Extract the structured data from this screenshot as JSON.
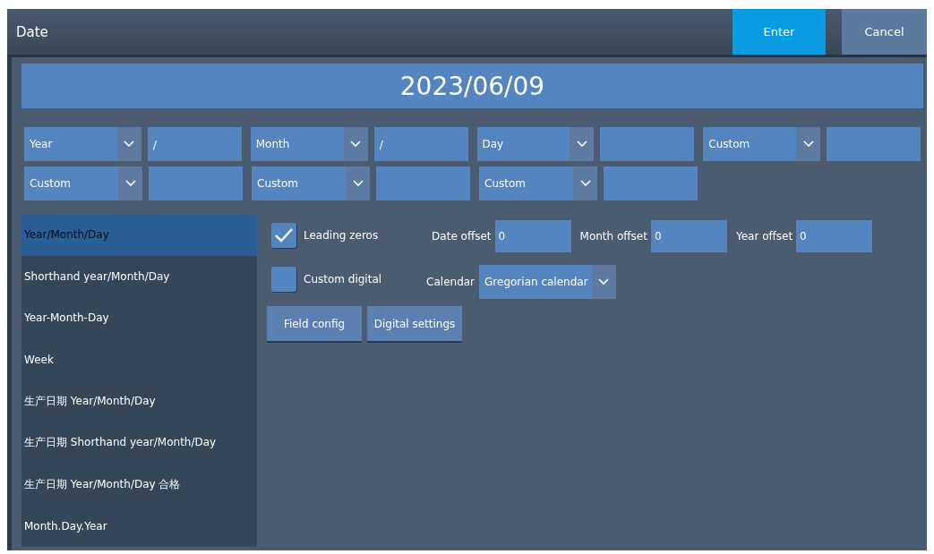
{
  "window": {
    "title": "Date"
  },
  "buttons": [
    {
      "label": "Enter",
      "kind": "primary"
    },
    {
      "label": "Cancel",
      "kind": "secondary"
    }
  ],
  "preview": "2023/06/09",
  "field_rows": [
    [
      {
        "kind": "select",
        "value": "Year"
      },
      {
        "kind": "input",
        "value": "/"
      },
      {
        "kind": "select",
        "value": "Month"
      },
      {
        "kind": "input",
        "value": "/"
      },
      {
        "kind": "select",
        "value": "Day"
      },
      {
        "kind": "input"
      },
      {
        "kind": "select",
        "value": "Custom"
      },
      {
        "kind": "input"
      }
    ],
    [
      {
        "kind": "select",
        "value": "Custom"
      },
      {
        "kind": "input"
      },
      {
        "kind": "select",
        "value": "Custom"
      },
      {
        "kind": "input"
      },
      {
        "kind": "select",
        "value": "Custom"
      },
      {
        "kind": "input"
      }
    ]
  ],
  "formats": [
    {
      "label": "Year/Month/Day",
      "selected": true
    },
    {
      "label": "Shorthand year/Month/Day",
      "selected": false
    },
    {
      "label": "Year-Month-Day",
      "selected": false
    },
    {
      "label": "Week",
      "selected": false
    },
    {
      "label": "生产日期 Year/Month/Day",
      "selected": false
    },
    {
      "label": "生产日期 Shorthand year/Month/Day",
      "selected": false
    },
    {
      "label": "生产日期 Year/Month/Day 合格",
      "selected": false
    },
    {
      "label": "Month.Day.Year",
      "selected": false
    }
  ],
  "options": [
    {
      "label": "Leading zeros",
      "checked": true
    },
    {
      "label": "Custom digital",
      "checked": false
    }
  ],
  "offsets": [
    {
      "label": "Date offset",
      "value": "0"
    },
    {
      "label": "Month offset",
      "value": "0"
    },
    {
      "label": "Year offset",
      "value": "0"
    }
  ],
  "calendar": {
    "label": "Calendar",
    "value": "Gregorian calendar"
  },
  "actions": [
    "Field config",
    "Digital settings"
  ]
}
